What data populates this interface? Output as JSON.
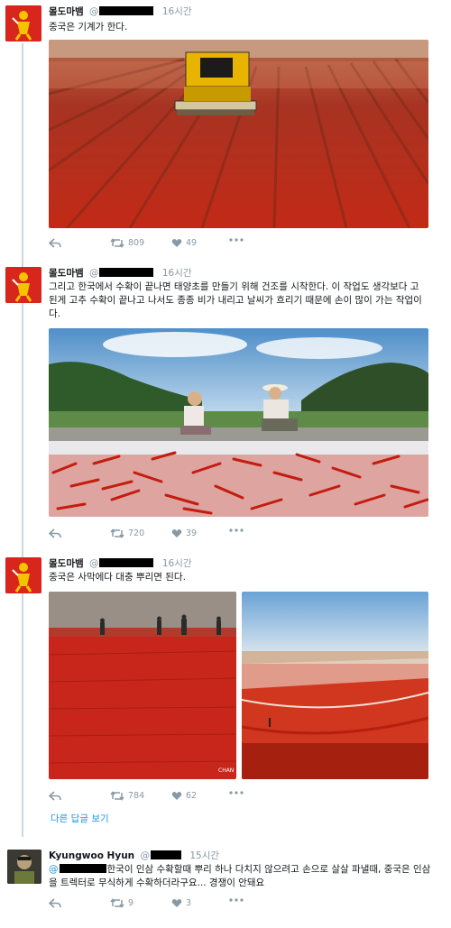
{
  "tweets": [
    {
      "name": "몰도마뱀",
      "handle": "@",
      "time": "16시간",
      "text": "중국은 기계가 한다.",
      "retweets": "809",
      "likes": "49"
    },
    {
      "name": "몰도마뱀",
      "handle": "@",
      "time": "16시간",
      "text": "그리고 한국에서 수확이 끝나면 태양초를 만들기 위해 건조를 시작한다. 이 작업도 생각보다 고된게 고추 수확이 끝나고 나서도 종종 비가 내리고 날씨가 흐리기 때문에 손이 많이 가는 작업이다.",
      "retweets": "720",
      "likes": "39"
    },
    {
      "name": "몰도마뱀",
      "handle": "@",
      "time": "16시간",
      "text": "중국은 사막에다 대충 뿌리면 된다.",
      "retweets": "784",
      "likes": "62",
      "watermark": "CHAN"
    }
  ],
  "more_replies_label": "다른 답글 보기",
  "reply": {
    "name": "Kyungwoo Hyun",
    "handle": "@",
    "time": "15시간",
    "mention": "@",
    "text": "한국이 인삼 수확할때 뿌리 하나 다치지 않으려고 손으로 살살 파낼때, 중국은 인삼을 트렉터로 무식하게 수확하더라구요... 경쟁이 안돼요",
    "retweets": "9",
    "likes": "3"
  },
  "colors": {
    "accent": "#1b95e0",
    "muted": "#8899a6",
    "thread_line": "#ccd6dd",
    "pepper_red": "#c8281a"
  }
}
